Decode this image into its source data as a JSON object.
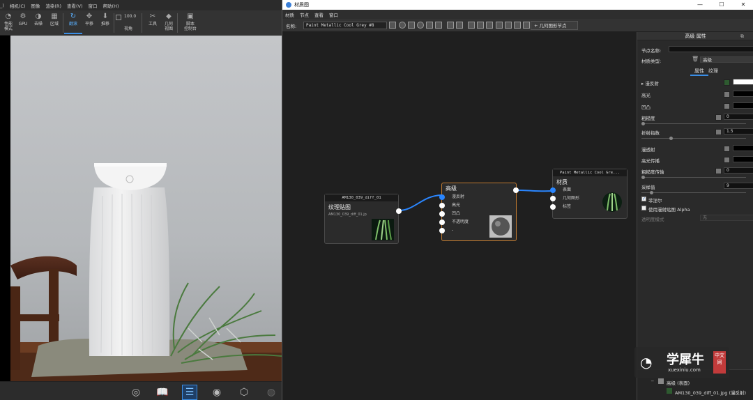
{
  "left_app": {
    "menu": [
      "_)",
      "相机(C)",
      "图像",
      "渲染(R)",
      "查看(V)",
      "窗口",
      "帮助(H)"
    ],
    "toolbar": [
      {
        "label": "性能\n模式",
        "icon": "speed-icon"
      },
      {
        "label": "GPU",
        "icon": "gpu-icon"
      },
      {
        "label": "去噪",
        "icon": "denoise-icon"
      },
      {
        "label": "区域",
        "icon": "region-icon"
      },
      {
        "label": "翻滚",
        "icon": "tumble-icon",
        "active": true
      },
      {
        "label": "平移",
        "icon": "pan-icon"
      },
      {
        "label": "推移",
        "icon": "dolly-icon"
      },
      {
        "label": "视角",
        "icon": "fov-icon"
      },
      {
        "label": "工具",
        "icon": "tools-icon"
      },
      {
        "label": "几何\n视图",
        "icon": "geometry-view-icon"
      },
      {
        "label": "脚本\n控制台",
        "icon": "script-console-icon"
      }
    ],
    "fov_value": "100.0",
    "bottom_toolbar": [
      "add-material-icon",
      "library-icon",
      "material-list-icon",
      "render-icon",
      "cube-icon",
      "camera-icon"
    ]
  },
  "material_window": {
    "title": "材质图",
    "menu": [
      "材质",
      "节点",
      "查看",
      "窗口"
    ],
    "name_label": "名称:",
    "name_value": "Paint Metallic Cool Grey #8",
    "geo_node_button": "几何图形节点",
    "win_controls": [
      "—",
      "☐",
      "✕"
    ]
  },
  "graph": {
    "texture_node": {
      "header": "AM130_039_diff_01",
      "title": "纹理贴图",
      "filename": "AM130_039_diff_01.jpg"
    },
    "advanced_node": {
      "title": "高级",
      "ports": [
        "漫反射",
        "高光",
        "凹凸",
        "不透明度",
        "-"
      ]
    },
    "material_node": {
      "header": "Paint Metallic Cool Gre...",
      "title": "材质",
      "ports": [
        "表面",
        "几何图形",
        "标签"
      ]
    }
  },
  "props": {
    "header": "高级 属性",
    "node_name_label": "节点名称:",
    "material_type_label": "材质类型:",
    "material_type_value": "高级",
    "tabs": [
      "属性",
      "纹理"
    ],
    "rows": {
      "diffuse": "漫反射",
      "specular": "高光",
      "bump": "凹凸",
      "roughness": "粗糙度",
      "roughness_value": "0",
      "ior": "折射指数",
      "ior_value": "1.5",
      "transmission": "漫透射",
      "specular_transmission": "高光传播",
      "roughness_transmission": "粗糙度传输",
      "roughness_transmission_value": "0",
      "samples": "采样值",
      "samples_value": "9",
      "fresnel": "菲涅尔",
      "use_diffuse_alpha": "使用漫射贴图 Alpha",
      "transparency_mode": "透明度模式",
      "transparency_mode_value": "无"
    },
    "tree": {
      "parent": "高级 (表面)",
      "child": "AM130_039_diff_01.jpg (漫反射)"
    }
  },
  "watermark": {
    "text": "学犀牛",
    "sub": "xuexiniu.com",
    "badge": "中文网"
  },
  "colors": {
    "accent": "#3a8ee6",
    "wire": "#2a86ff",
    "node_border_active": "#c07a30"
  }
}
